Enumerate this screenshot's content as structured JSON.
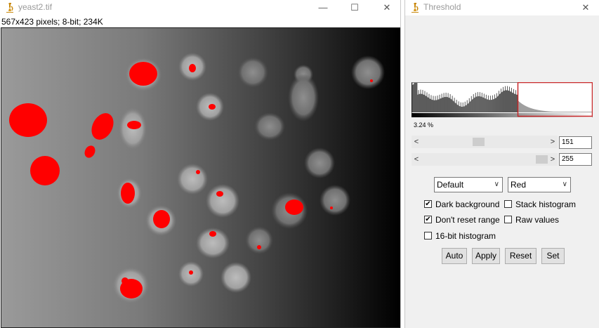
{
  "image_window": {
    "title": "yeast2.tif",
    "info": "567x423 pixels; 8-bit; 234K",
    "minimize_glyph": "—",
    "maximize_glyph": "☐",
    "close_glyph": "✕",
    "icon": "microscope-icon",
    "overlay_color": "#ff0000"
  },
  "threshold_window": {
    "title": "Threshold",
    "close_glyph": "✕",
    "icon": "microscope-icon",
    "percent_label": "3.24 %",
    "lower_slider": {
      "value": "151",
      "level": 151,
      "max": 255
    },
    "upper_slider": {
      "value": "255",
      "level": 255,
      "max": 255
    },
    "method_select": "Default",
    "display_select": "Red",
    "checkboxes": {
      "dark_background": {
        "label": "Dark background",
        "checked": true
      },
      "stack_histogram": {
        "label": "Stack histogram",
        "checked": false
      },
      "dont_reset_range": {
        "label": "Don't reset range",
        "checked": true
      },
      "raw_values": {
        "label": "Raw values",
        "checked": false
      },
      "bit16_histogram": {
        "label": "16-bit histogram",
        "checked": false
      }
    },
    "buttons": {
      "auto": "Auto",
      "apply": "Apply",
      "reset": "Reset",
      "set": "Set"
    },
    "arrow_left": "<",
    "arrow_right": ">",
    "chevron": "∨",
    "check_glyph": "✔",
    "histogram_highlight_color": "#c8282a"
  }
}
